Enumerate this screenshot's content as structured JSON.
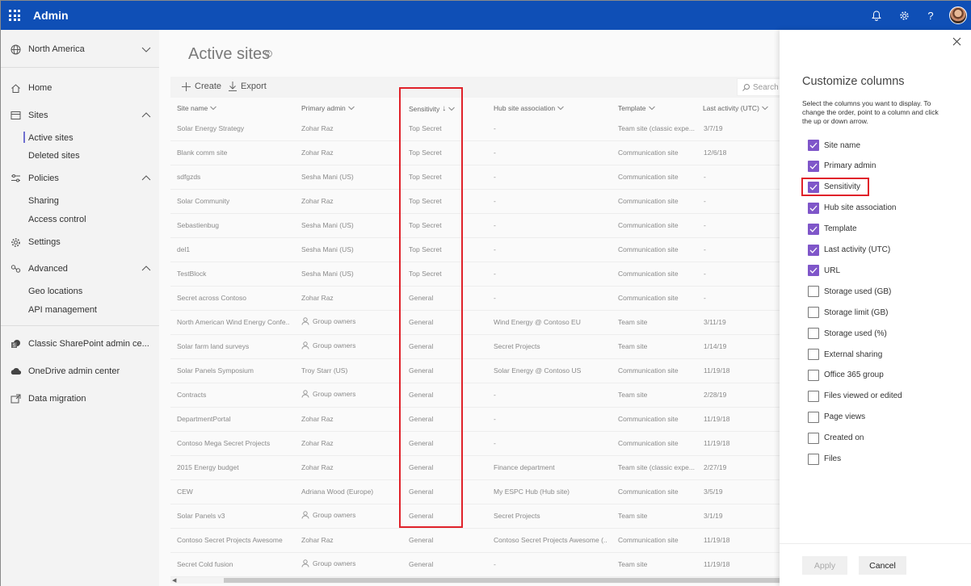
{
  "app": {
    "title": "Admin"
  },
  "sidebar": {
    "region": "North America",
    "home": "Home",
    "sites": {
      "label": "Sites",
      "children": [
        "Active sites",
        "Deleted sites"
      ]
    },
    "policies": {
      "label": "Policies",
      "children": [
        "Sharing",
        "Access control"
      ]
    },
    "settings": "Settings",
    "advanced": {
      "label": "Advanced",
      "children": [
        "Geo locations",
        "API management"
      ]
    },
    "classic": "Classic SharePoint admin ce...",
    "onedrive": "OneDrive admin center",
    "migration": "Data migration"
  },
  "main": {
    "title": "Active sites",
    "create": "Create",
    "export": "Export",
    "search_placeholder": "Search sit",
    "columns": [
      "Site name",
      "Primary admin",
      "Sensitivity",
      "Hub site association",
      "Template",
      "Last activity (UTC)"
    ],
    "rows": [
      {
        "name": "Solar Energy Strategy",
        "admin": "Zohar Raz",
        "group": false,
        "sens": "Top Secret",
        "hub": "-",
        "template": "Team site (classic expe...",
        "last": "3/7/19"
      },
      {
        "name": "Blank comm site",
        "admin": "Zohar Raz",
        "group": false,
        "sens": "Top Secret",
        "hub": "-",
        "template": "Communication site",
        "last": "12/6/18"
      },
      {
        "name": "sdfgzds",
        "admin": "Sesha Mani (US)",
        "group": false,
        "sens": "Top Secret",
        "hub": "-",
        "template": "Communication site",
        "last": "-"
      },
      {
        "name": "Solar Community",
        "admin": "Zohar Raz",
        "group": false,
        "sens": "Top Secret",
        "hub": "-",
        "template": "Communication site",
        "last": "-"
      },
      {
        "name": "Sebastienbug",
        "admin": "Sesha Mani (US)",
        "group": false,
        "sens": "Top Secret",
        "hub": "-",
        "template": "Communication site",
        "last": "-"
      },
      {
        "name": "del1",
        "admin": "Sesha Mani (US)",
        "group": false,
        "sens": "Top Secret",
        "hub": "-",
        "template": "Communication site",
        "last": "-"
      },
      {
        "name": "TestBlock",
        "admin": "Sesha Mani (US)",
        "group": false,
        "sens": "Top Secret",
        "hub": "-",
        "template": "Communication site",
        "last": "-"
      },
      {
        "name": "Secret across Contoso",
        "admin": "Zohar Raz",
        "group": false,
        "sens": "General",
        "hub": "-",
        "template": "Communication site",
        "last": "-"
      },
      {
        "name": "North American Wind Energy Confe...",
        "admin": "Group owners",
        "group": true,
        "sens": "General",
        "hub": "Wind Energy @ Contoso EU",
        "template": "Team site",
        "last": "3/11/19"
      },
      {
        "name": "Solar farm land surveys",
        "admin": "Group owners",
        "group": true,
        "sens": "General",
        "hub": "Secret Projects",
        "template": "Team site",
        "last": "1/14/19"
      },
      {
        "name": "Solar Panels Symposium",
        "admin": "Troy Starr (US)",
        "group": false,
        "sens": "General",
        "hub": "Solar Energy @ Contoso US",
        "template": "Communication site",
        "last": "11/19/18"
      },
      {
        "name": "Contracts",
        "admin": "Group owners",
        "group": true,
        "sens": "General",
        "hub": "-",
        "template": "Team site",
        "last": "2/28/19"
      },
      {
        "name": "DepartmentPortal",
        "admin": "Zohar Raz",
        "group": false,
        "sens": "General",
        "hub": "-",
        "template": "Communication site",
        "last": "11/19/18"
      },
      {
        "name": "Contoso Mega Secret Projects",
        "admin": "Zohar Raz",
        "group": false,
        "sens": "General",
        "hub": "-",
        "template": "Communication site",
        "last": "11/19/18"
      },
      {
        "name": "2015 Energy budget",
        "admin": "Zohar Raz",
        "group": false,
        "sens": "General",
        "hub": "Finance department",
        "template": "Team site (classic expe...",
        "last": "2/27/19"
      },
      {
        "name": "CEW",
        "admin": "Adriana Wood (Europe)",
        "group": false,
        "sens": "General",
        "hub": "My ESPC Hub (Hub site)",
        "template": "Communication site",
        "last": "3/5/19"
      },
      {
        "name": "Solar Panels v3",
        "admin": "Group owners",
        "group": true,
        "sens": "General",
        "hub": "Secret Projects",
        "template": "Team site",
        "last": "3/1/19"
      },
      {
        "name": "Contoso Secret Projects Awesome",
        "admin": "Zohar Raz",
        "group": false,
        "sens": "General",
        "hub": "Contoso Secret Projects Awesome (...",
        "template": "Communication site",
        "last": "11/19/18"
      },
      {
        "name": "Secret Cold fusion",
        "admin": "Group owners",
        "group": true,
        "sens": "General",
        "hub": "-",
        "template": "Team site",
        "last": "11/19/18"
      }
    ]
  },
  "panel": {
    "title": "Customize columns",
    "description": "Select the columns you want to display. To change the order, point to a column and click the up or down arrow.",
    "options": [
      {
        "label": "Site name",
        "checked": true
      },
      {
        "label": "Primary admin",
        "checked": true
      },
      {
        "label": "Sensitivity",
        "checked": true
      },
      {
        "label": "Hub site association",
        "checked": true
      },
      {
        "label": "Template",
        "checked": true
      },
      {
        "label": "Last activity (UTC)",
        "checked": true
      },
      {
        "label": "URL",
        "checked": true
      },
      {
        "label": "Storage used (GB)",
        "checked": false
      },
      {
        "label": "Storage limit (GB)",
        "checked": false
      },
      {
        "label": "Storage used (%)",
        "checked": false
      },
      {
        "label": "External sharing",
        "checked": false
      },
      {
        "label": "Office 365 group",
        "checked": false
      },
      {
        "label": "Files viewed or edited",
        "checked": false
      },
      {
        "label": "Page views",
        "checked": false
      },
      {
        "label": "Created on",
        "checked": false
      },
      {
        "label": "Files",
        "checked": false
      }
    ],
    "apply": "Apply",
    "cancel": "Cancel"
  },
  "colors": {
    "topbar": "#0f4fb6",
    "accent": "#7f56c9",
    "highlight": "#e0222a"
  }
}
